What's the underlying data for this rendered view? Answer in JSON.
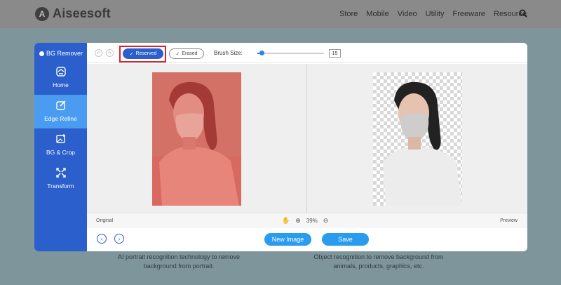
{
  "brand": {
    "name": "Aiseesoft",
    "mark": "A"
  },
  "nav": {
    "items": [
      "Store",
      "Mobile",
      "Video",
      "Utility",
      "Freeware",
      "Resource"
    ],
    "search_icon": "search-icon"
  },
  "app": {
    "title": "BG Remover",
    "sidebar": [
      {
        "label": "Home",
        "icon": "home-icon"
      },
      {
        "label": "Edge Refine",
        "icon": "edit-icon",
        "active": true
      },
      {
        "label": "BG & Crop",
        "icon": "crop-icon"
      },
      {
        "label": "Transform",
        "icon": "transform-icon"
      }
    ],
    "toolbar": {
      "reserved_label": "Reserved",
      "erased_label": "Erased",
      "brush_label": "Brush Size:",
      "brush_value": "15",
      "brush_slider_level": 0.06
    },
    "status": {
      "original": "Original",
      "preview": "Preview",
      "zoom": "39%"
    },
    "actions": {
      "new_image": "New Image",
      "save": "Save"
    }
  },
  "captions": {
    "left": "AI portrait recognition technology to remove background from portrait.",
    "right": "Object recognition to remove background from animals, products, graphics, etc."
  },
  "colors": {
    "sidebar": "#2a5fcc",
    "active": "#4a9cf0",
    "accent": "#2a9cf0",
    "highlight": "#e0202a"
  }
}
